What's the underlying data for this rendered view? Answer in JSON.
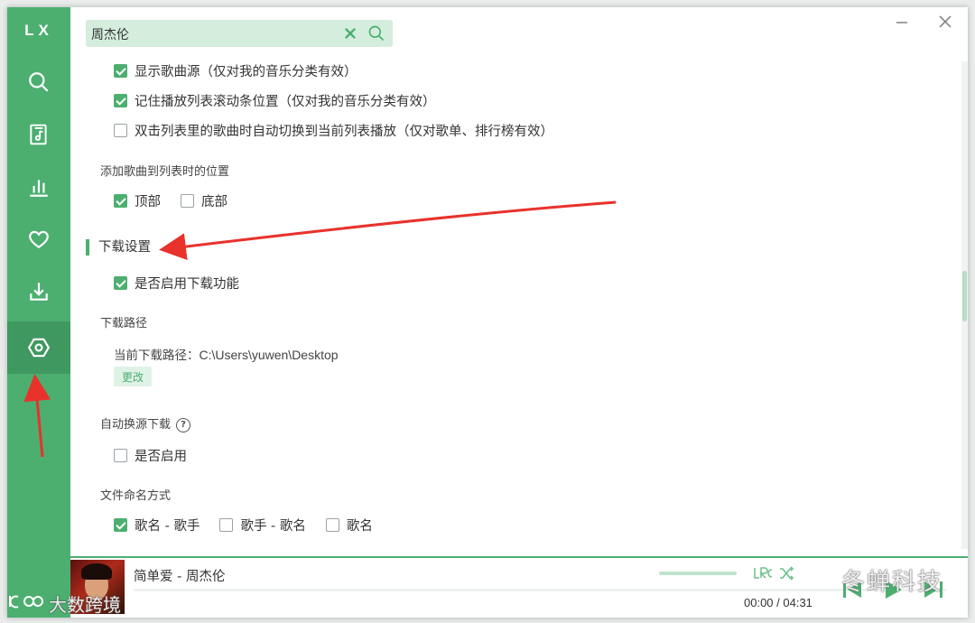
{
  "app": {
    "logo": "LX"
  },
  "sidebar": {
    "items": [
      {
        "name": "search",
        "icon": "search-icon"
      },
      {
        "name": "song-list",
        "icon": "music-file-icon"
      },
      {
        "name": "leaderboard",
        "icon": "bar-chart-icon"
      },
      {
        "name": "my-list",
        "icon": "heart-icon"
      },
      {
        "name": "download",
        "icon": "download-icon"
      },
      {
        "name": "settings",
        "icon": "settings-hexagon-icon",
        "active": true
      }
    ]
  },
  "search": {
    "value": "周杰伦"
  },
  "settings": {
    "list_options": [
      {
        "label": "显示歌曲源（仅对我的音乐分类有效）",
        "checked": true
      },
      {
        "label": "记住播放列表滚动条位置（仅对我的音乐分类有效）",
        "checked": true
      },
      {
        "label": "双击列表里的歌曲时自动切换到当前列表播放（仅对歌单、排行榜有效）",
        "checked": false
      }
    ],
    "add_position": {
      "title": "添加歌曲到列表时的位置",
      "options": [
        {
          "label": "顶部",
          "checked": true
        },
        {
          "label": "底部",
          "checked": false
        }
      ]
    },
    "download": {
      "section_title": "下载设置",
      "enable": {
        "label": "是否启用下载功能",
        "checked": true
      },
      "path_title": "下载路径",
      "path_label": "当前下载路径：",
      "path_value": "C:\\Users\\yuwen\\Desktop",
      "change_button": "更改",
      "auto_switch_title": "自动换源下载",
      "auto_switch_help": "?",
      "auto_switch": {
        "label": "是否启用",
        "checked": false
      },
      "naming_title": "文件命名方式",
      "naming_options": [
        {
          "label": "歌名 - 歌手",
          "checked": true
        },
        {
          "label": "歌手 - 歌名",
          "checked": false
        },
        {
          "label": "歌名",
          "checked": false
        }
      ]
    }
  },
  "player": {
    "title": "简单爱 - 周杰伦",
    "time": "00:00 / 04:31",
    "progress": 0
  },
  "watermarks": {
    "right": "冬蝉科技",
    "left": "大数跨境"
  },
  "colors": {
    "accent": "#4caf70",
    "accent_dark": "#3f9860",
    "search_bg": "#d4eddc",
    "annotation_arrow": "#e8322b"
  }
}
